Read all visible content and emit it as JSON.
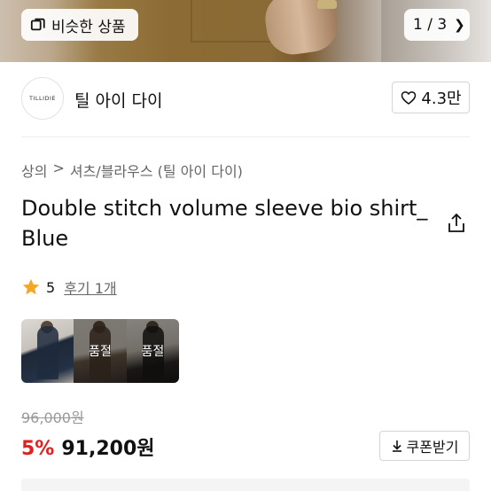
{
  "hero": {
    "similar_label": "비슷한 상품",
    "pager_text": "1 / 3"
  },
  "shop": {
    "logo_text": "TILLIDIE",
    "name": "틸 아이 다이",
    "likes": "4.3만"
  },
  "breadcrumb": {
    "category": "상의",
    "separator": ">",
    "subcategory": "셔츠/블라우스 (틸 아이 다이)"
  },
  "product": {
    "title": "Double stitch volume sleeve bio shirt_ Blue"
  },
  "rating": {
    "score": "5",
    "review_text": "후기 1개"
  },
  "options": [
    {
      "status": ""
    },
    {
      "status": "품절"
    },
    {
      "status": "품절"
    }
  ],
  "price": {
    "original": "96,000원",
    "discount": "5%",
    "final": "91,200원",
    "coupon_label": "쿠폰받기"
  },
  "colors": {
    "discount": "#e02020",
    "star": "#f5a623"
  }
}
